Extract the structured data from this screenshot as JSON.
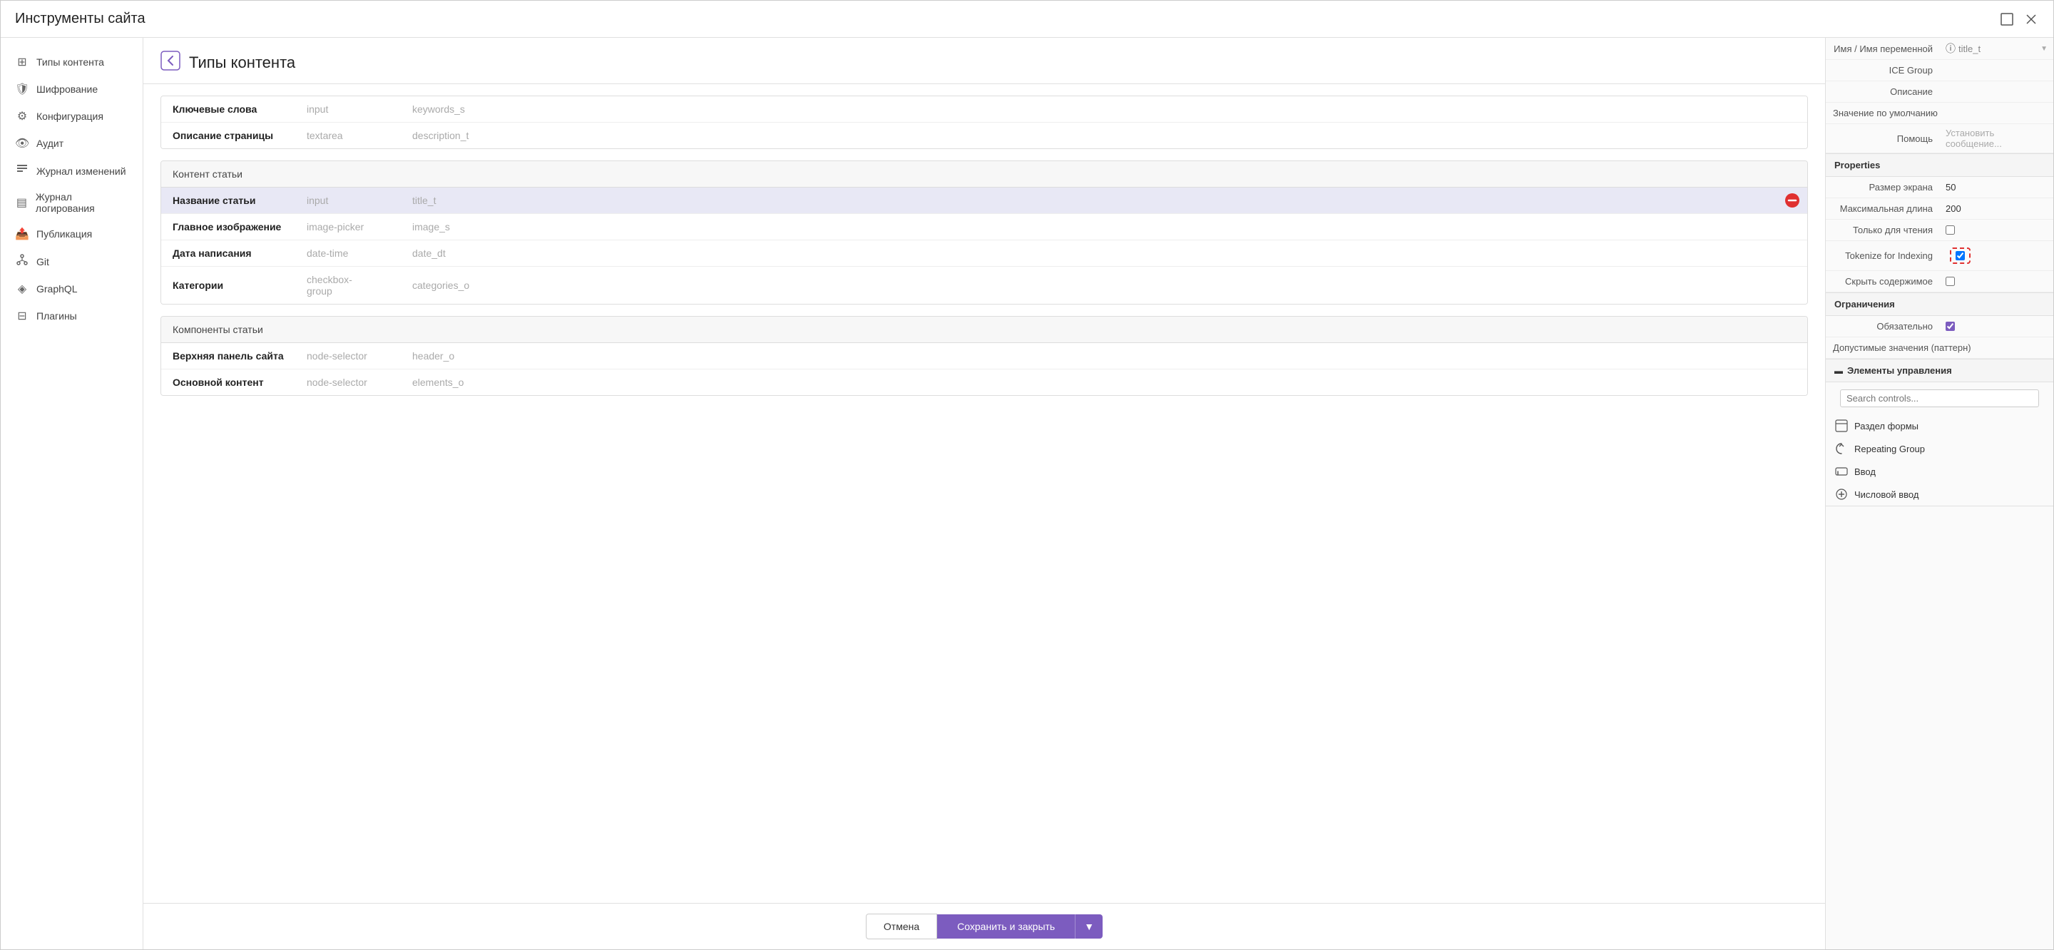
{
  "window": {
    "title": "Инструменты сайта"
  },
  "sidebar": {
    "items": [
      {
        "id": "content-types",
        "label": "Типы контента",
        "icon": "⊞"
      },
      {
        "id": "encryption",
        "label": "Шифрование",
        "icon": "🛡"
      },
      {
        "id": "configuration",
        "label": "Конфигурация",
        "icon": "⚙"
      },
      {
        "id": "audit",
        "label": "Аудит",
        "icon": "👁"
      },
      {
        "id": "change-log",
        "label": "Журнал изменений",
        "icon": "≡"
      },
      {
        "id": "log",
        "label": "Журнал логирования",
        "icon": "▤"
      },
      {
        "id": "publication",
        "label": "Публикация",
        "icon": "📤"
      },
      {
        "id": "git",
        "label": "Git",
        "icon": "⑂"
      },
      {
        "id": "graphql",
        "label": "GraphQL",
        "icon": "◈"
      },
      {
        "id": "plugins",
        "label": "Плагины",
        "icon": "⊟"
      }
    ]
  },
  "content": {
    "header": {
      "title": "Типы контента",
      "icon": "←"
    },
    "sections": [
      {
        "id": "keywords-section",
        "rows": [
          {
            "id": "keywords",
            "name": "Ключевые слова",
            "type": "input",
            "key": "keywords_s"
          },
          {
            "id": "page-desc",
            "name": "Описание страницы",
            "type": "textarea",
            "key": "description_t"
          }
        ]
      },
      {
        "id": "article-content",
        "title": "Контент статьи",
        "rows": [
          {
            "id": "article-title",
            "name": "Название статьи",
            "type": "input",
            "key": "title_t",
            "selected": true,
            "has_delete": true
          },
          {
            "id": "main-image",
            "name": "Главное изображение",
            "type": "image-picker",
            "key": "image_s"
          },
          {
            "id": "write-date",
            "name": "Дата написания",
            "type": "date-time",
            "key": "date_dt"
          },
          {
            "id": "categories",
            "name": "Категории",
            "type": "checkbox-\ngroup",
            "key": "categories_o"
          }
        ]
      },
      {
        "id": "article-components",
        "title": "Компоненты статьи",
        "rows": [
          {
            "id": "top-panel",
            "name": "Верхняя панель сайта",
            "type": "node-selector",
            "key": "header_o"
          },
          {
            "id": "main-content",
            "name": "Основной контент",
            "type": "node-selector",
            "key": "elements_o"
          },
          {
            "id": "more-row",
            "name": "...",
            "type": "node-selector",
            "key": "..."
          }
        ]
      }
    ]
  },
  "footer": {
    "cancel_label": "Отмена",
    "save_label": "Сохранить и закрыть",
    "arrow_label": "▼"
  },
  "right_panel": {
    "top_section": {
      "name_label": "Имя / Имя переменной",
      "name_value": "title_t",
      "ice_group_label": "ICE Group",
      "description_label": "Описание",
      "default_value_label": "Значение по умолчанию",
      "help_label": "Помощь",
      "help_placeholder": "Установить сообщение..."
    },
    "properties": {
      "title": "Properties",
      "screen_size_label": "Размер экрана",
      "screen_size_value": "50",
      "max_length_label": "Максимальная длина",
      "max_length_value": "200",
      "readonly_label": "Только для чтения",
      "tokenize_label": "Tokenize for Indexing",
      "tokenize_checked": true,
      "hide_label": "Скрыть содержимое"
    },
    "constraints": {
      "title": "Ограничения",
      "required_label": "Обязательно",
      "required_checked": true,
      "pattern_label": "Допустимые значения (паттерн)"
    },
    "controls": {
      "title": "Элементы управления",
      "search_placeholder": "Search controls...",
      "items": [
        {
          "id": "form-section",
          "label": "Раздел формы",
          "icon": "form"
        },
        {
          "id": "repeating-group",
          "label": "Repeating Group",
          "icon": "repeat"
        },
        {
          "id": "input",
          "label": "Ввод",
          "icon": "input"
        },
        {
          "id": "number-input",
          "label": "Числовой ввод",
          "icon": "number"
        }
      ]
    }
  }
}
